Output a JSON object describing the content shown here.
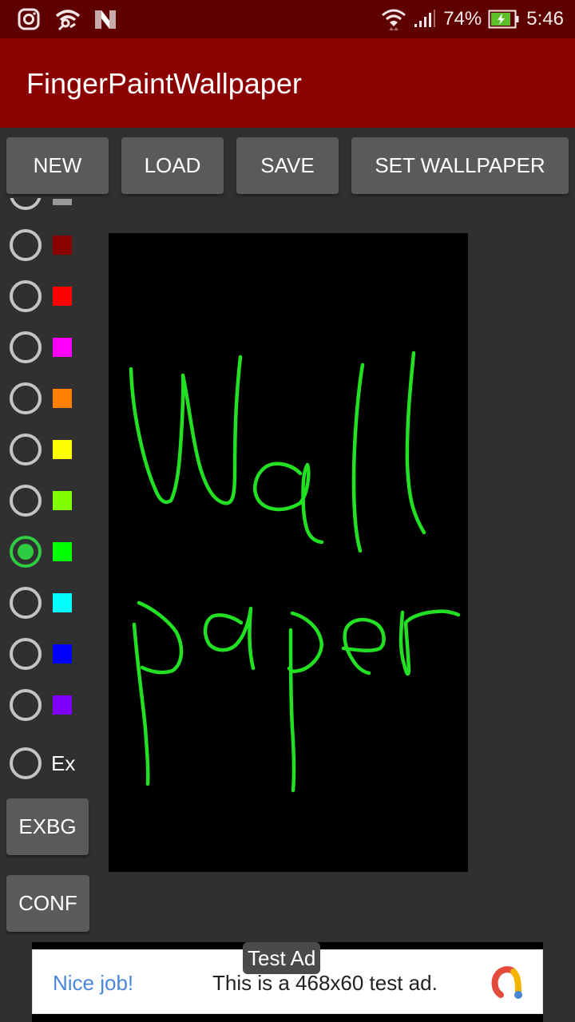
{
  "status_bar": {
    "icons_left": [
      "instagram-icon",
      "wifi-hotspot-icon",
      "n-app-icon"
    ],
    "battery_percent": "74%",
    "battery_level": 0.74,
    "battery_charging": true,
    "time": "5:46"
  },
  "app_bar": {
    "title": "FingerPaintWallpaper"
  },
  "toolbar": {
    "new_label": "NEW",
    "load_label": "LOAD",
    "save_label": "SAVE",
    "set_wallpaper_label": "SET WALLPAPER"
  },
  "palette": {
    "selected_index": 7,
    "colors": [
      {
        "name": "gray",
        "hex": "#999999"
      },
      {
        "name": "dark-red",
        "hex": "#8b0000"
      },
      {
        "name": "red",
        "hex": "#ff0000"
      },
      {
        "name": "magenta",
        "hex": "#ff00ff"
      },
      {
        "name": "orange",
        "hex": "#ff8000"
      },
      {
        "name": "yellow",
        "hex": "#ffff00"
      },
      {
        "name": "yellow-green",
        "hex": "#80ff00"
      },
      {
        "name": "green",
        "hex": "#00ff00"
      },
      {
        "name": "cyan",
        "hex": "#00ffff"
      },
      {
        "name": "blue",
        "hex": "#0000ff"
      },
      {
        "name": "violet",
        "hex": "#8000ff"
      }
    ],
    "extra_label": "Ex"
  },
  "side_buttons": {
    "exbg_label": "EXBG",
    "conf_label": "CONF"
  },
  "canvas": {
    "background": "#000000",
    "stroke_color": "#22e022",
    "drawn_text": "Wall paper"
  },
  "ad": {
    "badge": "Test Ad",
    "headline": "Nice job!",
    "body": "This is a 468x60 test ad."
  },
  "colors": {
    "status_bar": "#5e0000",
    "app_bar": "#8b0000",
    "background": "#303030",
    "button": "#5a5a5a",
    "accent": "#2ecc40"
  }
}
